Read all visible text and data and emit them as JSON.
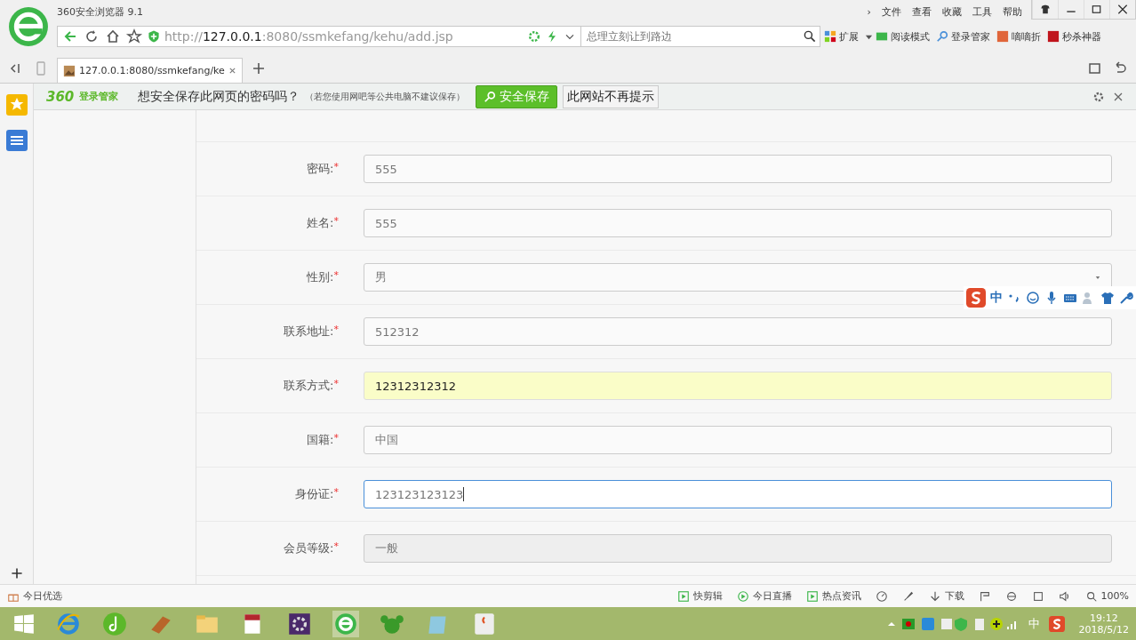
{
  "browser": {
    "title": "360安全浏览器 9.1",
    "more": "›",
    "menu": [
      "文件",
      "查看",
      "收藏",
      "工具",
      "帮助"
    ],
    "address": {
      "scheme": "http://",
      "host": "127.0.0.1",
      "rest": ":8080/ssmkefang/kehu/add.jsp"
    },
    "search": {
      "placeholder": "总理立刻让到路边"
    },
    "toolbar": [
      "扩展",
      "阅读模式",
      "登录管家",
      "嘀嘀折",
      "秒杀神器"
    ],
    "tabs": [
      {
        "label": "127.0.0.1:8080/ssmkefang/ke",
        "selected": true
      }
    ]
  },
  "password_bar": {
    "brand": "360",
    "brand_sub": "登录管家",
    "question": "想安全保存此网页的密码吗？",
    "note": "（若您使用网吧等公共电脑不建议保存）",
    "save": "安全保存",
    "never": "此网站不再提示"
  },
  "form": [
    {
      "label": "密码:",
      "required_mark": "*",
      "kind": "input",
      "value": "555",
      "autofilled": false,
      "focused": false,
      "disabled": false
    },
    {
      "label": "姓名:",
      "required_mark": "*",
      "kind": "input",
      "value": "555",
      "autofilled": false,
      "focused": false,
      "disabled": false
    },
    {
      "label": "性别:",
      "required_mark": "*",
      "kind": "select",
      "value": "男",
      "autofilled": false,
      "focused": false,
      "disabled": false
    },
    {
      "label": "联系地址:",
      "required_mark": "*",
      "kind": "input",
      "value": "512312",
      "autofilled": false,
      "focused": false,
      "disabled": false
    },
    {
      "label": "联系方式:",
      "required_mark": "*",
      "kind": "input",
      "value": "12312312312",
      "autofilled": true,
      "focused": false,
      "disabled": false
    },
    {
      "label": "国籍:",
      "required_mark": "*",
      "kind": "input",
      "value": "中国",
      "autofilled": false,
      "focused": false,
      "disabled": false
    },
    {
      "label": "身份证:",
      "required_mark": "*",
      "kind": "input",
      "value": "123123123123",
      "autofilled": false,
      "focused": true,
      "disabled": false
    },
    {
      "label": "会员等级:",
      "required_mark": "*",
      "kind": "input",
      "value": "一般",
      "autofilled": false,
      "focused": false,
      "disabled": true
    }
  ],
  "ime": {
    "mode": "中"
  },
  "status_bar": {
    "left": "今日优选",
    "items": [
      "快剪辑",
      "今日直播",
      "热点资讯"
    ],
    "download": "下载",
    "zoom": "100%"
  },
  "taskbar": {
    "tray_lang": "中",
    "time": "19:12",
    "date": "2018/5/12"
  }
}
